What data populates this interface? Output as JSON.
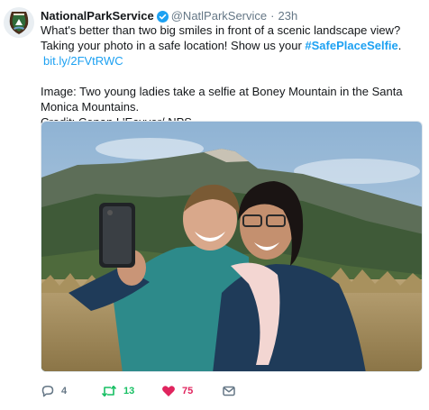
{
  "tweet": {
    "display_name": "NationalParkService",
    "handle": "@NatlParkService",
    "separator": "·",
    "time": "23h",
    "text_line1": "What's better than two big smiles in front of a scenic landscape view? Taking your photo in a safe location! Show us your ",
    "hashtag": "#SafePlaceSelfie",
    "link": "bit.ly/2FVtRWC",
    "text_line2": "Image: Two young ladies take a selfie at Boney Mountain in the Santa Monica Mountains.",
    "text_line3": "Credit: Conan L'Ecuyer/ NPS"
  },
  "actions": {
    "reply_count": "4",
    "retweet_count": "13",
    "like_count": "75"
  },
  "colors": {
    "link": "#1da1f2",
    "retweet": "#17bf63",
    "like": "#e0245e",
    "muted": "#657786"
  },
  "icons": {
    "avatar": "nps-arrowhead-logo",
    "verified": "verified-badge-icon",
    "reply": "reply-icon",
    "retweet": "retweet-icon",
    "like": "heart-icon",
    "message": "envelope-icon"
  }
}
